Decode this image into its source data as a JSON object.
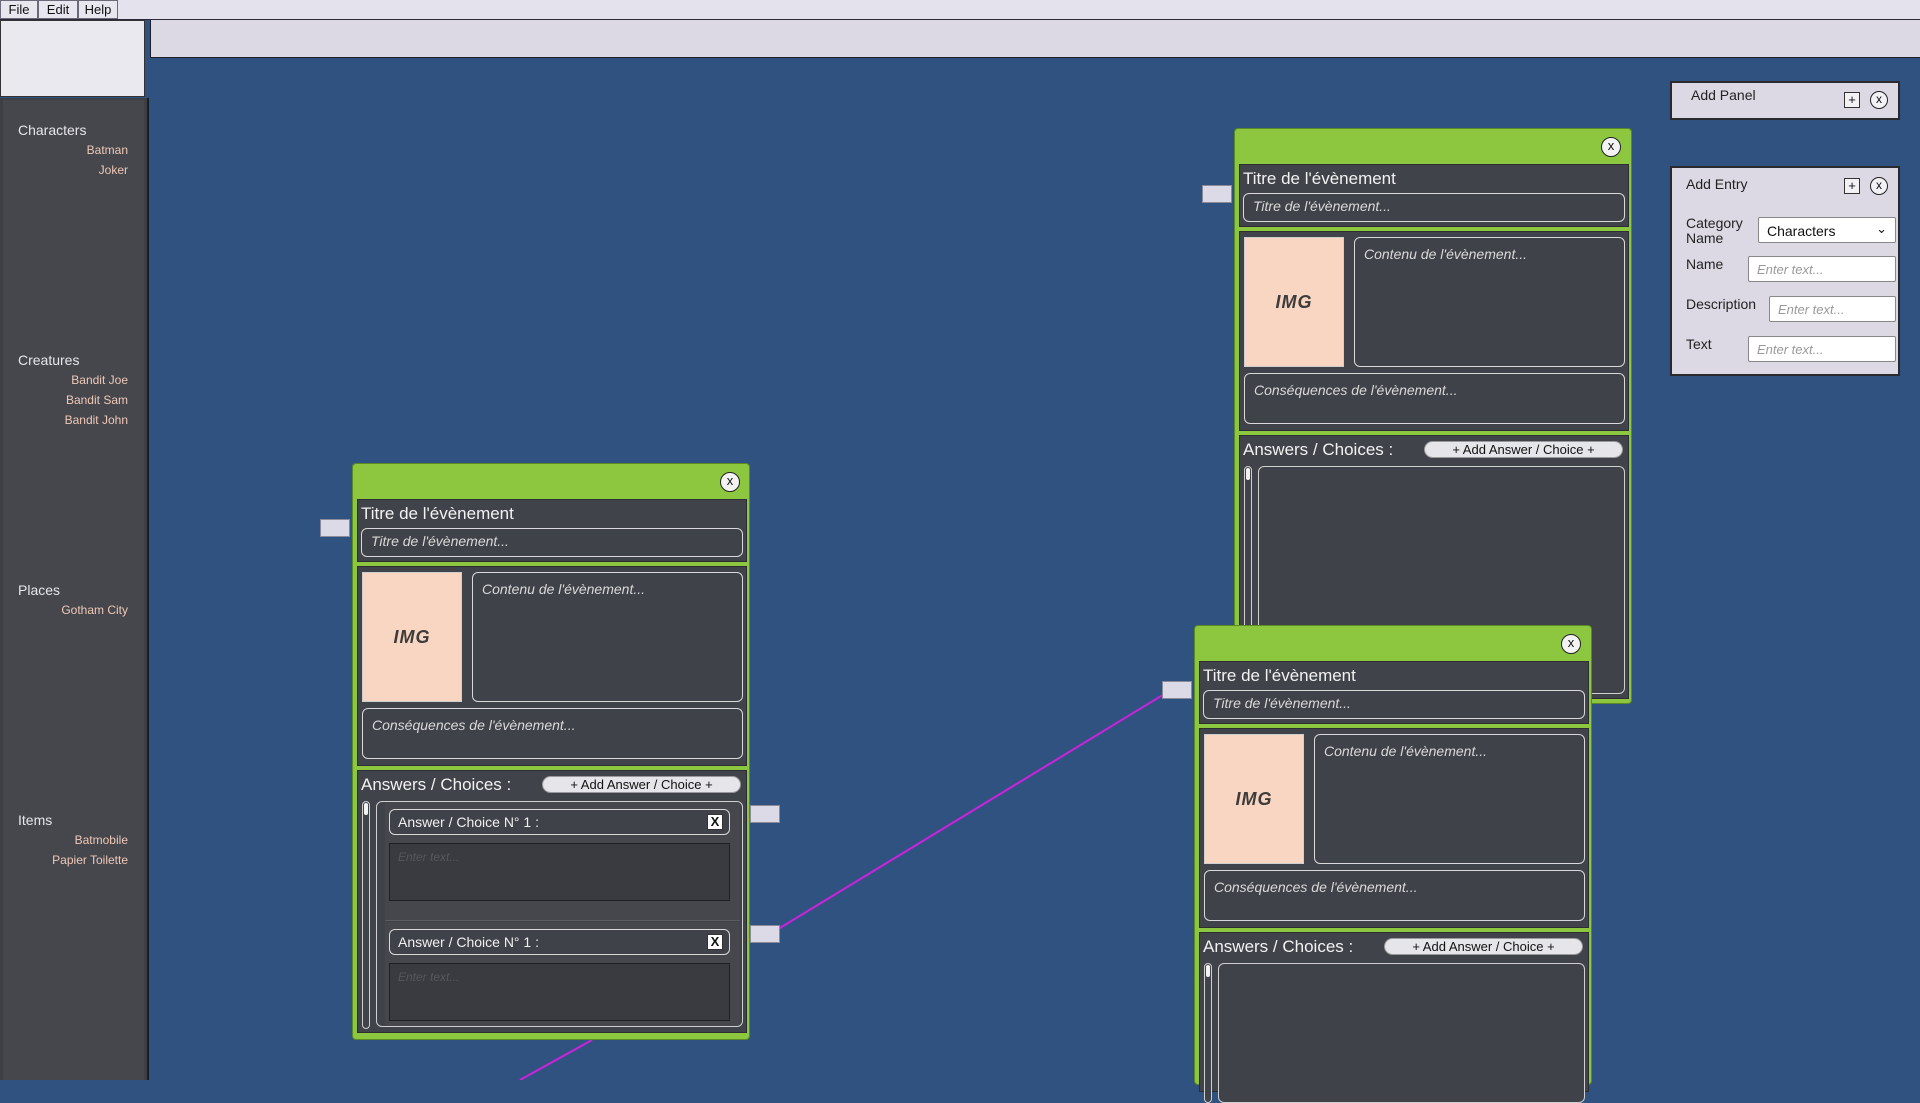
{
  "menu": {
    "file": "File",
    "edit": "Edit",
    "help": "Help"
  },
  "sidebar": {
    "categories": [
      {
        "label": "Characters",
        "items": [
          "Batman",
          "Joker"
        ]
      },
      {
        "label": "Creatures",
        "items": [
          "Bandit Joe",
          "Bandit Sam",
          "Bandit John"
        ]
      },
      {
        "label": "Places",
        "items": [
          "Gotham City"
        ]
      },
      {
        "label": "Items",
        "items": [
          "Batmobile",
          "Papier Toilette"
        ]
      }
    ]
  },
  "add_panel": {
    "title": "Add Panel",
    "plus": "+",
    "close": "x"
  },
  "add_entry": {
    "title": "Add Entry",
    "plus": "+",
    "close": "x",
    "category_label": "Category Name",
    "category_value": "Characters",
    "name_label": "Name",
    "description_label": "Description",
    "text_label": "Text",
    "placeholder": "Enter text..."
  },
  "event_node": {
    "section_title": "Titre de l'évènement",
    "title_placeholder": "Titre de l'évènement...",
    "img_label": "IMG",
    "content_placeholder": "Contenu de l'évènement...",
    "consequences_placeholder": "Conséquences de l'évènement...",
    "answers_title": "Answers / Choices :",
    "add_answer": "+ Add Answer / Choice +",
    "close": "x",
    "answer_label": "Answer / Choice N° 1 :",
    "answer_remove": "X",
    "answer_placeholder": "Enter text..."
  },
  "colors": {
    "canvas": "#2f5280",
    "node_green": "#8dc63f",
    "wire": "#cc22dd",
    "img_placeholder": "#f9d6c2"
  }
}
